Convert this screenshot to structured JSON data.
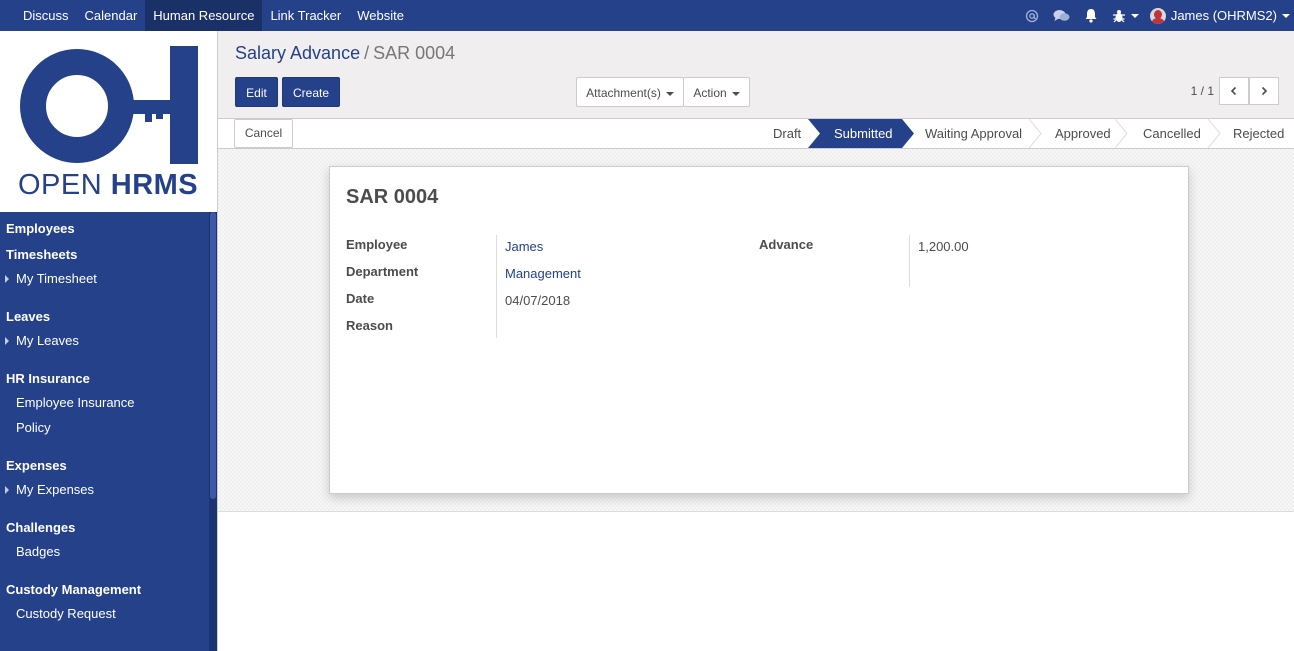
{
  "topbar": {
    "menu": [
      "Discuss",
      "Calendar",
      "Human Resource",
      "Link Tracker",
      "Website"
    ],
    "active_menu": "Human Resource",
    "icons": [
      "at-icon",
      "chat-icon",
      "bell-icon",
      "bug-icon"
    ],
    "user_name": "James (OHRMS2)",
    "bar_color": "#24418a"
  },
  "logo": {
    "text_light": "OPEN",
    "text_bold": "HRMS"
  },
  "sidebar": {
    "sections": [
      {
        "title": "Employees",
        "items": []
      },
      {
        "title": "Timesheets",
        "items": [
          "My Timesheet"
        ]
      },
      {
        "title": "Leaves",
        "items": [
          "My Leaves"
        ]
      },
      {
        "title": "HR Insurance",
        "items": [
          "Employee Insurance",
          "Policy"
        ]
      },
      {
        "title": "Expenses",
        "items": [
          "My Expenses"
        ]
      },
      {
        "title": "Challenges",
        "items": [
          "Badges"
        ]
      },
      {
        "title": "Custody Management",
        "items": [
          "Custody Request"
        ]
      }
    ]
  },
  "breadcrumb": {
    "parent": "Salary Advance",
    "separator": "/",
    "current": "SAR 0004"
  },
  "buttons": {
    "edit": "Edit",
    "create": "Create",
    "attachments": "Attachment(s)",
    "action": "Action",
    "cancel": "Cancel"
  },
  "pager": {
    "text": "1 / 1"
  },
  "statusbar": {
    "stages": [
      "Draft",
      "Submitted",
      "Waiting Approval",
      "Approved",
      "Cancelled",
      "Rejected"
    ],
    "active": "Submitted"
  },
  "form": {
    "title": "SAR 0004",
    "employee_label": "Employee",
    "employee_value": "James",
    "department_label": "Department",
    "department_value": "Management",
    "date_label": "Date",
    "date_value": "04/07/2018",
    "reason_label": "Reason",
    "reason_value": "",
    "advance_label": "Advance",
    "advance_value": "1,200.00"
  }
}
